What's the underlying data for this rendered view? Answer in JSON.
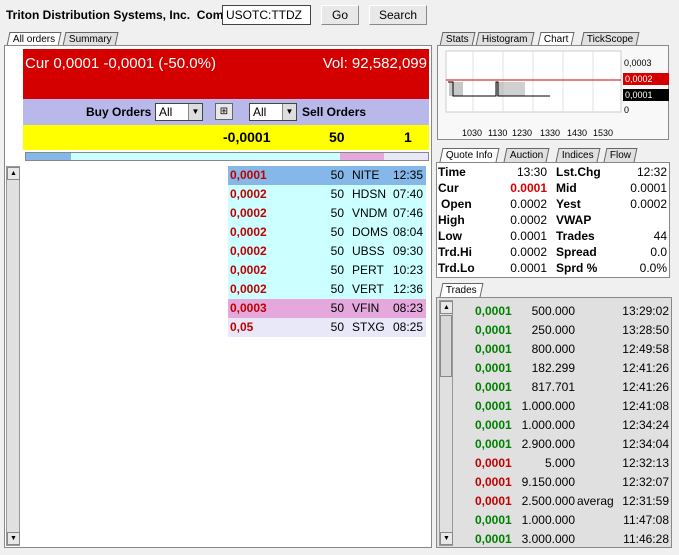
{
  "header": {
    "title": "Triton Distribution Systems, Inc.",
    "title_suffix": "Com",
    "symbol": "USOTC:TTDZ",
    "go": "Go",
    "search": "Search"
  },
  "left_tabs": [
    "All orders",
    "Summary"
  ],
  "summary": {
    "cur": "Cur 0,0001 -0,0001 (-50.0%)",
    "vol": "Vol: 92,582,099"
  },
  "filter": {
    "buy_label": "Buy Orders",
    "buy_select": "All",
    "sell_select": "All",
    "sell_label": "Sell Orders"
  },
  "best": {
    "price": "-0,0001",
    "size": "50",
    "count": "1"
  },
  "depth_bar": {
    "colors": {
      "left": "#85b8e8",
      "mid": "#ccffff",
      "pink": "#e5a8dd",
      "right": "#e8e8f8"
    }
  },
  "sell_orders": [
    {
      "price": "0,0001",
      "size": "50",
      "mm": "NITE",
      "time": "12:35",
      "bg": "#85b8e8"
    },
    {
      "price": "0,0002",
      "size": "50",
      "mm": "HDSN",
      "time": "07:40",
      "bg": "#ccffff"
    },
    {
      "price": "0,0002",
      "size": "50",
      "mm": "VNDM",
      "time": "07:46",
      "bg": "#ccffff"
    },
    {
      "price": "0,0002",
      "size": "50",
      "mm": "DOMS",
      "time": "08:04",
      "bg": "#ccffff"
    },
    {
      "price": "0,0002",
      "size": "50",
      "mm": "UBSS",
      "time": "09:30",
      "bg": "#ccffff"
    },
    {
      "price": "0,0002",
      "size": "50",
      "mm": "PERT",
      "time": "10:23",
      "bg": "#ccffff"
    },
    {
      "price": "0,0002",
      "size": "50",
      "mm": "VERT",
      "time": "12:36",
      "bg": "#ccffff"
    },
    {
      "price": "0,0003",
      "size": "50",
      "mm": "VFIN",
      "time": "08:23",
      "bg": "#e5a8dd"
    },
    {
      "price": "0,05",
      "size": "50",
      "mm": "STXG",
      "time": "08:25",
      "bg": "#e8e8f8"
    }
  ],
  "right_tabs_top": [
    "Stats",
    "Histogram",
    "Chart",
    "TickScope"
  ],
  "chart": {
    "y_labels": [
      "0,0003",
      "0,0002",
      "0,0001",
      "0"
    ],
    "x_labels": [
      "1030",
      "1130",
      "1230",
      "1330",
      "1430",
      "1530"
    ]
  },
  "quote_tabs": [
    "Quote Info",
    "Auction",
    "Indices",
    "Flow"
  ],
  "quote": [
    {
      "l1": "Time",
      "v1": "13:30",
      "l2": "Lst.Chg",
      "v2": "12:32"
    },
    {
      "l1": "Cur",
      "v1": "0.0001",
      "l2": "Mid",
      "v2": "0.0001"
    },
    {
      "l1": "Open",
      "v1": "0.0002",
      "l2": "Yest",
      "v2": "0.0002"
    },
    {
      "l1": "High",
      "v1": "0.0002",
      "l2": "VWAP",
      "v2": ""
    },
    {
      "l1": "Low",
      "v1": "0.0001",
      "l2": "Trades",
      "v2": "44"
    },
    {
      "l1": "Trd.Hi",
      "v1": "0.0002",
      "l2": "Spread",
      "v2": "0.0"
    },
    {
      "l1": "Trd.Lo",
      "v1": "0.0001",
      "l2": "Sprd %",
      "v2": "0.0%"
    }
  ],
  "trades_tab": "Trades",
  "trades": [
    {
      "price": "0,0001",
      "vol": "500.000",
      "cond": "",
      "time": "13:29:02",
      "color": "#008000"
    },
    {
      "price": "0,0001",
      "vol": "250.000",
      "cond": "",
      "time": "13:28:50",
      "color": "#008000"
    },
    {
      "price": "0,0001",
      "vol": "800.000",
      "cond": "",
      "time": "12:49:58",
      "color": "#008000"
    },
    {
      "price": "0,0001",
      "vol": "182.299",
      "cond": "",
      "time": "12:41:26",
      "color": "#008000"
    },
    {
      "price": "0,0001",
      "vol": "817.701",
      "cond": "",
      "time": "12:41:26",
      "color": "#008000"
    },
    {
      "price": "0,0001",
      "vol": "1.000.000",
      "cond": "",
      "time": "12:41:08",
      "color": "#008000"
    },
    {
      "price": "0,0001",
      "vol": "1.000.000",
      "cond": "",
      "time": "12:34:24",
      "color": "#008000"
    },
    {
      "price": "0,0001",
      "vol": "2.900.000",
      "cond": "",
      "time": "12:34:04",
      "color": "#008000"
    },
    {
      "price": "0,0001",
      "vol": "5.000",
      "cond": "",
      "time": "12:32:13",
      "color": "#c00000"
    },
    {
      "price": "0,0001",
      "vol": "9.150.000",
      "cond": "",
      "time": "12:32:07",
      "color": "#c00000"
    },
    {
      "price": "0,0001",
      "vol": "2.500.000",
      "cond": "averag",
      "time": "12:31:59",
      "color": "#c00000"
    },
    {
      "price": "0,0001",
      "vol": "1.000.000",
      "cond": "",
      "time": "11:47:08",
      "color": "#008000"
    },
    {
      "price": "0,0001",
      "vol": "3.000.000",
      "cond": "",
      "time": "11:46:28",
      "color": "#008000"
    }
  ]
}
